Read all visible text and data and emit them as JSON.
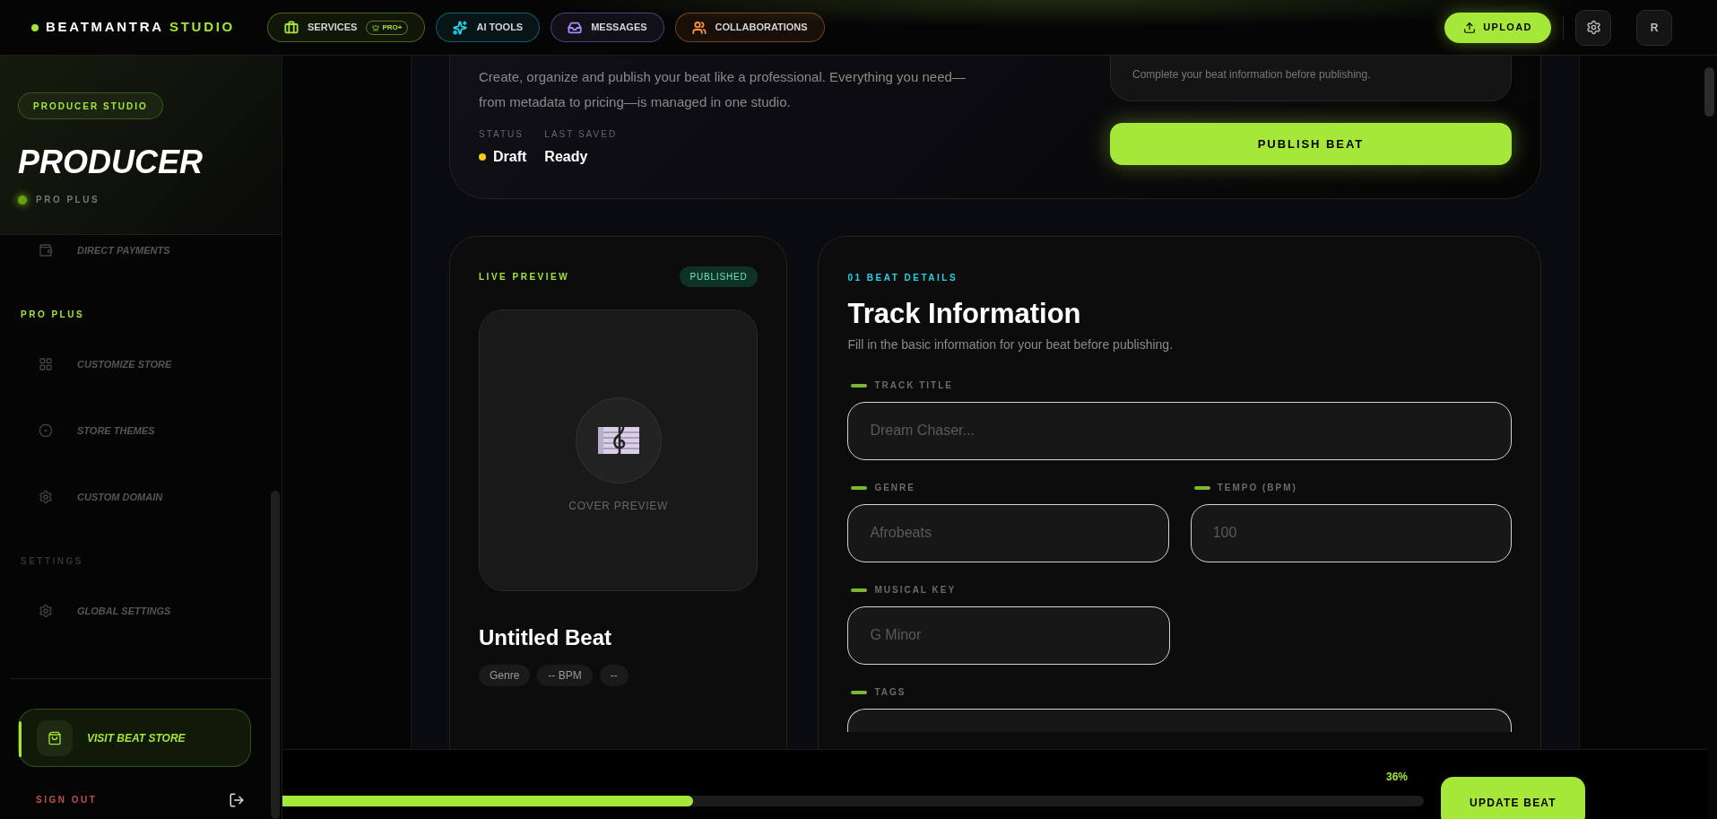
{
  "header": {
    "logo": {
      "name": "BEATMANTRA",
      "accent": "STUDIO"
    },
    "nav": [
      {
        "label": "SERVICES",
        "color": "#a3e635",
        "badge": "PRO+"
      },
      {
        "label": "AI TOOLS",
        "color": "#22d3ee"
      },
      {
        "label": "MESSAGES",
        "color": "#a78bfa"
      },
      {
        "label": "COLLABORATIONS",
        "color": "#fb923c"
      }
    ],
    "upload": "UPLOAD",
    "avatar": "R"
  },
  "sidebar": {
    "badge": "PRODUCER STUDIO",
    "name": "PRODUCER",
    "plan": "PRO PLUS",
    "sections": [
      {
        "items": [
          {
            "label": "DIRECT PAYMENTS"
          }
        ]
      },
      {
        "title": "PRO PLUS",
        "kind": "accent",
        "items": [
          {
            "label": "CUSTOMIZE STORE"
          },
          {
            "label": "STORE THEMES"
          },
          {
            "label": "CUSTOM DOMAIN"
          }
        ]
      },
      {
        "title": "SETTINGS",
        "kind": "muted",
        "items": [
          {
            "label": "GLOBAL SETTINGS"
          }
        ]
      }
    ],
    "visit_store": "VISIT BEAT STORE",
    "sign_out": "SIGN OUT"
  },
  "hero": {
    "description": "Create, organize and publish your beat like a professional. Everything you need—from metadata to pricing—is managed in one studio.",
    "status": {
      "label": "STATUS",
      "value": "Draft"
    },
    "last_saved": {
      "label": "LAST SAVED",
      "value": "Ready"
    },
    "notice": "Complete your beat information before publishing.",
    "publish": "PUBLISH BEAT"
  },
  "preview": {
    "title": "LIVE PREVIEW",
    "badge": "PUBLISHED",
    "cover_label": "COVER PREVIEW",
    "beat_title": "Untitled Beat",
    "chips": [
      "Genre",
      "-- BPM",
      "--"
    ]
  },
  "details": {
    "step": "01 BEAT DETAILS",
    "title": "Track Information",
    "subtitle": "Fill in the basic information for your beat before publishing.",
    "fields": [
      {
        "label": "TRACK TITLE",
        "placeholder": "Dream Chaser..."
      },
      {
        "label": "GENRE",
        "placeholder": "Afrobeats"
      },
      {
        "label": "TEMPO (BPM)",
        "placeholder": "100"
      },
      {
        "label": "MUSICAL KEY",
        "placeholder": "G Minor"
      },
      {
        "label": "TAGS"
      }
    ]
  },
  "footer": {
    "progress": {
      "level": 0.36,
      "reading": "36%"
    },
    "update": "UPDATE BEAT"
  }
}
